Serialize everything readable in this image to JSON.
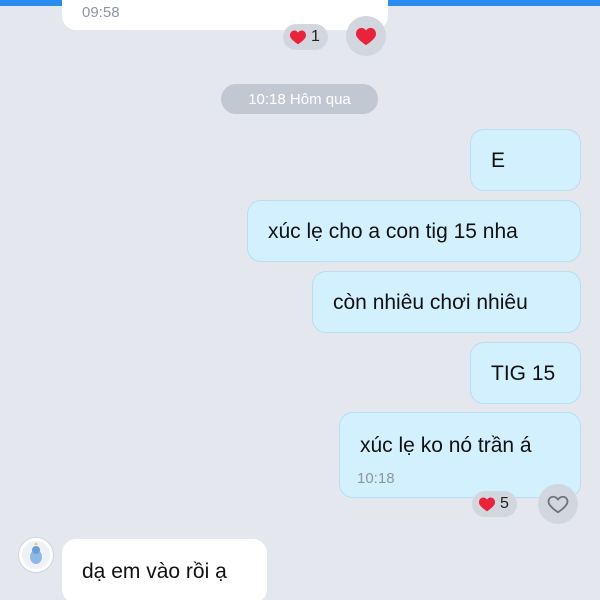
{
  "chat": {
    "prev_time": "09:58",
    "prev_reaction": {
      "icon": "heart-filled-icon",
      "count": "1"
    },
    "date_separator": "10:18 Hôm qua",
    "messages": [
      {
        "text": "E"
      },
      {
        "text": "xúc lẹ cho a con tig 15 nha"
      },
      {
        "text": "còn nhiêu chơi nhiêu"
      },
      {
        "text": "TIG 15"
      },
      {
        "text": "xúc lẹ ko nó trần á",
        "time": "10:18"
      }
    ],
    "last_reaction": {
      "icon": "heart-filled-icon",
      "count": "5"
    },
    "incoming_last": {
      "text": "dạ em vào rồi ạ"
    }
  },
  "colors": {
    "background": "#e4e7ee",
    "outgoing_bubble": "#d2f0fd",
    "incoming_bubble": "#ffffff",
    "heart": "#e8233a",
    "accent_bar": "#2a8cf0"
  }
}
